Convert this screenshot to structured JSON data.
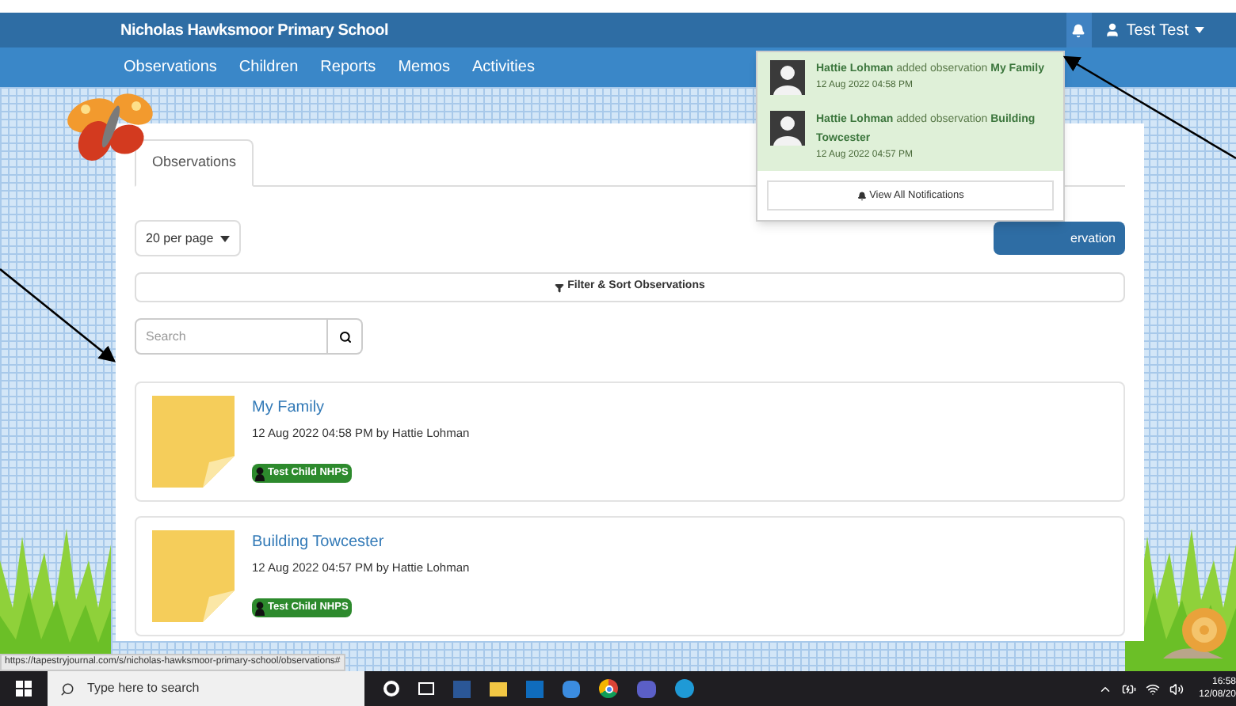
{
  "header": {
    "school": "Nicholas Hawksmoor Primary School",
    "user": "Test Test"
  },
  "nav": [
    "Observations",
    "Children",
    "Reports",
    "Memos",
    "Activities"
  ],
  "notifications": {
    "items": [
      {
        "text": "**Hattie Lohman** added observation **My Family**",
        "time": "12 Aug 2022 04:58 PM"
      },
      {
        "text": "**Hattie Lohman** added observation **Building Towcester**",
        "time": "12 Aug 2022 04:57 PM"
      }
    ],
    "view_all": "View All Notifications"
  },
  "tabs": [
    {
      "label": "Observations",
      "selected": true
    }
  ],
  "per_page": "20 per page",
  "add_button": "ervation",
  "filter": "Filter & Sort Observations",
  "search": {
    "placeholder": "Search"
  },
  "observations": [
    {
      "title": "My Family",
      "meta": "12 Aug 2022 04:58 PM by Hattie Lohman",
      "child": "Test Child NHPS"
    },
    {
      "title": "Building Towcester",
      "meta": "12 Aug 2022 04:57 PM by Hattie Lohman",
      "child": "Test Child NHPS"
    }
  ],
  "status_url": "https://tapestryjournal.com/s/nicholas-hawksmoor-primary-school/observations#",
  "taskbar": {
    "search_placeholder": "Type here to search",
    "time": "16:58",
    "date": "12/08/20"
  }
}
